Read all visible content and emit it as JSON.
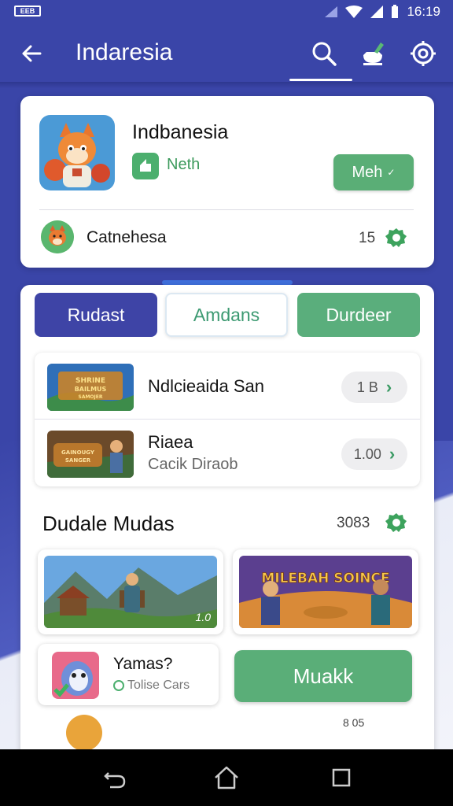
{
  "status_bar": {
    "time": "16:19",
    "left_badge": "EEB"
  },
  "app_bar": {
    "title": "Indaresia"
  },
  "hero": {
    "title": "Indbanesia",
    "subtitle": "Neth",
    "button_label": "Meh",
    "developer_name": "Catnehesa",
    "developer_count": "15"
  },
  "segments": [
    "Rudast",
    "Amdans",
    "Durdeer"
  ],
  "list": [
    {
      "title": "Ndlcieaida San",
      "subtitle": "",
      "pill": "1 B",
      "thumb_text": "SHRINE BAILMUS SAMOJER"
    },
    {
      "title": "Riaea",
      "subtitle": "Cacik Diraob",
      "pill": "1.00",
      "thumb_text": "GAINOUGY SANGER"
    }
  ],
  "section": {
    "title": "Dudale Mudas",
    "count": "3083"
  },
  "media": [
    {
      "tag": "1.0"
    },
    {
      "overlay": "MILEBAH SOINCE"
    }
  ],
  "mini_card": {
    "title": "Yamas?",
    "subtitle": "Tolise Cars"
  },
  "cta": {
    "label": "Muakk"
  },
  "peek": {
    "text": "8    05"
  },
  "colors": {
    "primary": "#3a45a8",
    "accent_green": "#5aae78",
    "card_bg": "#ffffff"
  }
}
